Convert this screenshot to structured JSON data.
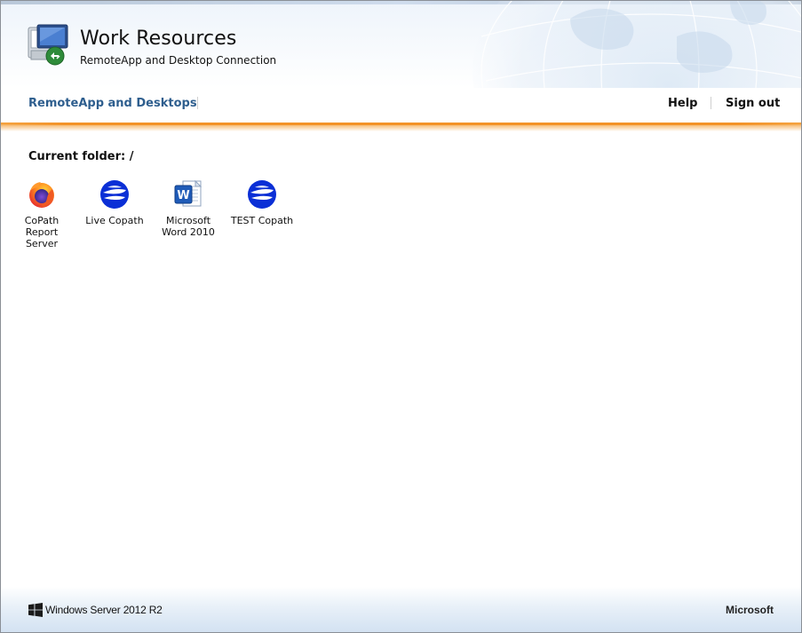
{
  "header": {
    "title": "Work Resources",
    "subtitle": "RemoteApp and Desktop Connection",
    "app_icon": "remote-desktop-icon"
  },
  "nav": {
    "remoteapp_label": "RemoteApp and Desktops",
    "help_label": "Help",
    "signout_label": "Sign out"
  },
  "content": {
    "current_folder": "Current folder: /",
    "apps": [
      {
        "name": "CoPath Report Server",
        "line1": "CoPath",
        "line2": "Report Server",
        "icon": "firefox-icon"
      },
      {
        "name": "Live Copath",
        "line1": "Live Copath",
        "line2": "",
        "icon": "copath-globe-icon"
      },
      {
        "name": "Microsoft Word 2010",
        "line1": "Microsoft",
        "line2": "Word 2010",
        "icon": "word-icon"
      },
      {
        "name": "TEST Copath",
        "line1": "TEST Copath",
        "line2": "",
        "icon": "copath-globe-icon"
      }
    ]
  },
  "footer": {
    "windows_text": "Windows Server 2012 R2",
    "microsoft_text": "Microsoft"
  },
  "colors": {
    "nav_link": "#2e5e8e",
    "accent_orange": "#f39227",
    "footer_blue": "#d3e2f2"
  }
}
